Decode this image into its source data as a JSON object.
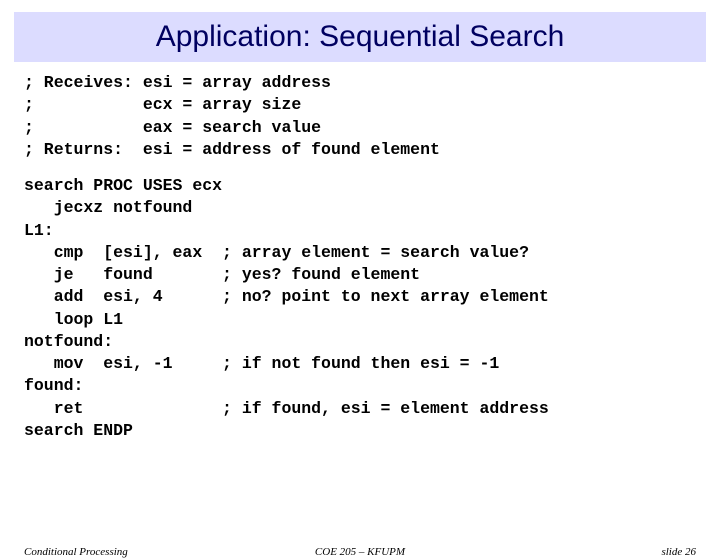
{
  "title": "Application: Sequential Search",
  "header_lines": [
    "; Receives: esi = array address",
    ";           ecx = array size",
    ";           eax = search value",
    "; Returns:  esi = address of found element"
  ],
  "body_lines": [
    "search PROC USES ecx",
    "   jecxz notfound",
    "L1:",
    "   cmp  [esi], eax  ; array element = search value?",
    "   je   found       ; yes? found element",
    "   add  esi, 4      ; no? point to next array element",
    "   loop L1",
    "notfound:",
    "   mov  esi, -1     ; if not found then esi = -1",
    "found:",
    "   ret              ; if found, esi = element address",
    "search ENDP"
  ],
  "footer": {
    "left": "Conditional Processing",
    "center": "COE 205 – KFUPM",
    "right": "slide 26"
  }
}
